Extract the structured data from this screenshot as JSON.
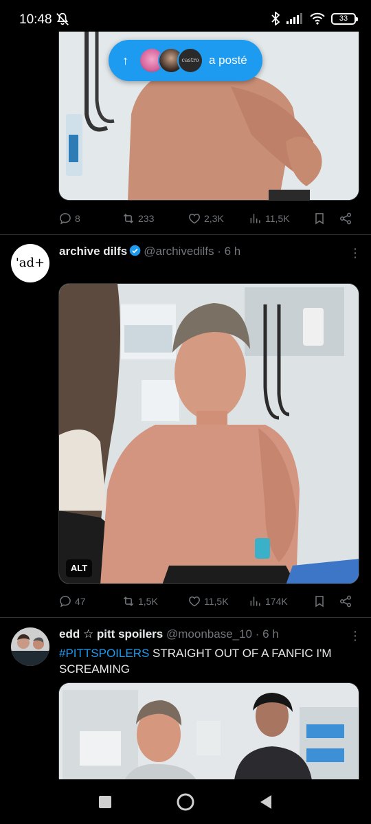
{
  "status_bar": {
    "time": "10:48",
    "battery": "33"
  },
  "posted_pill": {
    "avatar3_text": "castro",
    "label": "a posté"
  },
  "tweet1": {
    "replies": "8",
    "retweets": "233",
    "likes": "2,3K",
    "views": "11,5K"
  },
  "tweet2": {
    "avatar_text": "'ad+",
    "name": "archive dilfs",
    "handle": "@archivedilfs",
    "time": "· 6 h",
    "alt_label": "ALT",
    "replies": "47",
    "retweets": "1,5K",
    "likes": "11,5K",
    "views": "174K"
  },
  "tweet3": {
    "name": "edd ☆ pitt spoilers",
    "handle": "@moonbase_10",
    "time": "· 6 h",
    "hashtag": "#PITTSPOILERS",
    "text": " STRAIGHT OUT OF A FANFIC I'M SCREAMING"
  },
  "colors": {
    "accent": "#1d9bf0",
    "muted": "#71767b",
    "background": "#000000"
  }
}
